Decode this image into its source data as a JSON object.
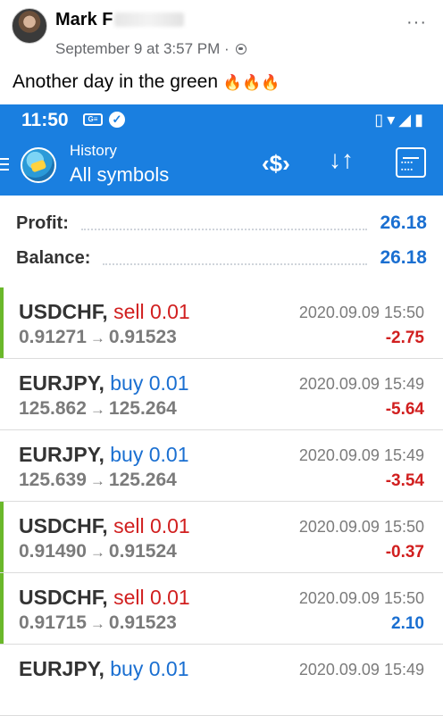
{
  "post": {
    "author": "Mark F",
    "timestamp": "September 9 at 3:57 PM ·",
    "text": "Another day in the green",
    "emoji": "🔥🔥🔥",
    "more": "···"
  },
  "statusbar": {
    "time": "11:50",
    "icons": [
      "ge-icon",
      "check-icon",
      "vibrate-icon",
      "wifi-icon",
      "signal-icon",
      "battery-icon"
    ],
    "right_glyphs": "▯▾◢▮"
  },
  "toolbar": {
    "title": "History",
    "subtitle": "All symbols",
    "currency_glyph": "‹$›",
    "sort_glyph": "↓↑",
    "accent": "#1a7fe0"
  },
  "summary": {
    "profit_label": "Profit:",
    "profit_value": "26.18",
    "balance_label": "Balance:",
    "balance_value": "26.18"
  },
  "colors": {
    "buy": "#1a6fd1",
    "sell": "#d11f1f",
    "profit_bar": "#6ab82a"
  },
  "trades": [
    {
      "symbol": "USDCHF,",
      "side": "sell 0.01",
      "type": "sell",
      "open": "0.91271",
      "close": "0.91523",
      "time": "2020.09.09 15:50",
      "profit": "-2.75",
      "bar": true
    },
    {
      "symbol": "EURJPY,",
      "side": "buy 0.01",
      "type": "buy",
      "open": "125.862",
      "close": "125.264",
      "time": "2020.09.09 15:49",
      "profit": "-5.64",
      "bar": false
    },
    {
      "symbol": "EURJPY,",
      "side": "buy 0.01",
      "type": "buy",
      "open": "125.639",
      "close": "125.264",
      "time": "2020.09.09 15:49",
      "profit": "-3.54",
      "bar": false
    },
    {
      "symbol": "USDCHF,",
      "side": "sell 0.01",
      "type": "sell",
      "open": "0.91490",
      "close": "0.91524",
      "time": "2020.09.09 15:50",
      "profit": "-0.37",
      "bar": true
    },
    {
      "symbol": "USDCHF,",
      "side": "sell 0.01",
      "type": "sell",
      "open": "0.91715",
      "close": "0.91523",
      "time": "2020.09.09 15:50",
      "profit": "2.10",
      "bar": true
    },
    {
      "symbol": "EURJPY,",
      "side": "buy 0.01",
      "type": "buy",
      "open": "",
      "close": "",
      "time": "2020.09.09 15:49",
      "profit": "",
      "bar": false
    }
  ],
  "arrow": "→"
}
